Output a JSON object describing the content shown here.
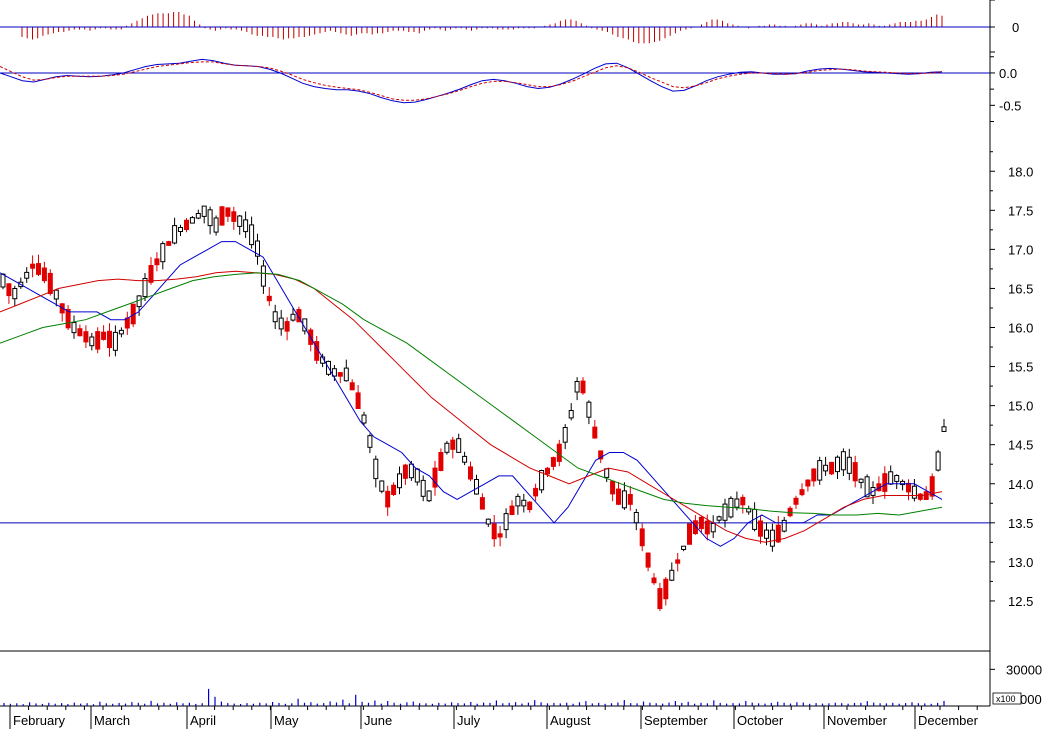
{
  "chart_data": [
    {
      "type": "bar",
      "panel": "histogram",
      "zero_label": "0",
      "values": [
        -0.08,
        -0.09,
        -0.1,
        -0.09,
        -0.07,
        -0.06,
        -0.05,
        -0.04,
        -0.04,
        -0.03,
        -0.02,
        -0.02,
        -0.02,
        -0.03,
        -0.02,
        -0.01,
        -0.01,
        -0.02,
        -0.02,
        -0.02,
        0.01,
        0.03,
        0.05,
        0.07,
        0.09,
        0.1,
        0.11,
        0.11,
        0.11,
        0.12,
        0.12,
        0.1,
        0.09,
        0.05,
        0.02,
        -0.01,
        -0.02,
        -0.03,
        -0.02,
        -0.01,
        -0.02,
        -0.02,
        -0.03,
        -0.04,
        -0.06,
        -0.07,
        -0.07,
        -0.08,
        -0.08,
        -0.09,
        -0.1,
        -0.09,
        -0.09,
        -0.08,
        -0.08,
        -0.07,
        -0.06,
        -0.05,
        -0.04,
        -0.03,
        -0.04,
        -0.05,
        -0.06,
        -0.07,
        -0.06,
        -0.05,
        -0.05,
        -0.06,
        -0.05,
        -0.05,
        -0.04,
        -0.03,
        -0.03,
        -0.03,
        -0.04,
        -0.04,
        -0.05,
        -0.03,
        -0.02,
        -0.01,
        -0.02,
        -0.03,
        -0.02,
        -0.01,
        -0.01,
        -0.02,
        -0.03,
        -0.02,
        -0.01,
        -0.01,
        -0.01,
        -0.02,
        -0.02,
        -0.02,
        -0.02,
        -0.01,
        -0.01,
        -0.01,
        -0.01,
        0.0,
        0.01,
        0.02,
        0.03,
        0.05,
        0.06,
        0.06,
        0.05,
        0.03,
        0.01,
        -0.01,
        -0.02,
        -0.03,
        -0.04,
        -0.06,
        -0.08,
        -0.09,
        -0.1,
        -0.12,
        -0.13,
        -0.13,
        -0.13,
        -0.12,
        -0.11,
        -0.09,
        -0.07,
        -0.05,
        -0.03,
        -0.02,
        -0.01,
        0.0,
        0.02,
        0.04,
        0.06,
        0.06,
        0.05,
        0.03,
        0.02,
        0.01,
        0.0,
        -0.01,
        0.0,
        0.01,
        0.01,
        0.02,
        0.02,
        0.01,
        0.01,
        0.0,
        0.01,
        0.02,
        0.03,
        0.03,
        0.02,
        0.01,
        0.02,
        0.03,
        0.03,
        0.04,
        0.04,
        0.03,
        0.02,
        0.02,
        0.03,
        0.02,
        0.01,
        0.01,
        0.02,
        0.03,
        0.04,
        0.04,
        0.04,
        0.05,
        0.05,
        0.06,
        0.08,
        0.1,
        0.09
      ],
      "ylim": [
        -0.2,
        0.2
      ]
    },
    {
      "type": "line",
      "panel": "oscillator",
      "tick_labels": [
        "0.0",
        "-0.5"
      ],
      "ylim": [
        -0.85,
        0.2
      ],
      "series": [
        {
          "values": [
            0.0,
            -0.06,
            -0.12,
            -0.14,
            -0.1,
            -0.06,
            -0.04,
            -0.05,
            -0.06,
            -0.05,
            -0.03,
            0.0,
            0.05,
            0.1,
            0.13,
            0.14,
            0.15,
            0.18,
            0.21,
            0.19,
            0.15,
            0.12,
            0.11,
            0.1,
            0.06,
            0.0,
            -0.08,
            -0.16,
            -0.21,
            -0.24,
            -0.26,
            -0.26,
            -0.28,
            -0.32,
            -0.38,
            -0.43,
            -0.46,
            -0.45,
            -0.41,
            -0.36,
            -0.31,
            -0.25,
            -0.18,
            -0.12,
            -0.1,
            -0.12,
            -0.16,
            -0.21,
            -0.24,
            -0.22,
            -0.17,
            -0.1,
            -0.02,
            0.07,
            0.14,
            0.15,
            0.08,
            -0.02,
            -0.12,
            -0.21,
            -0.28,
            -0.27,
            -0.2,
            -0.12,
            -0.06,
            -0.02,
            0.01,
            0.02,
            0.0,
            -0.02,
            -0.02,
            -0.01,
            0.03,
            0.06,
            0.07,
            0.06,
            0.04,
            0.02,
            0.01,
            0.0,
            -0.01,
            -0.02,
            -0.01,
            0.01,
            0.02
          ]
        },
        {
          "values": [
            0.1,
            0.02,
            -0.06,
            -0.11,
            -0.1,
            -0.07,
            -0.05,
            -0.05,
            -0.05,
            -0.05,
            -0.04,
            -0.02,
            0.02,
            0.06,
            0.1,
            0.12,
            0.14,
            0.16,
            0.17,
            0.17,
            0.14,
            0.12,
            0.11,
            0.1,
            0.08,
            0.03,
            -0.03,
            -0.1,
            -0.15,
            -0.19,
            -0.22,
            -0.24,
            -0.26,
            -0.3,
            -0.35,
            -0.4,
            -0.42,
            -0.42,
            -0.4,
            -0.36,
            -0.32,
            -0.27,
            -0.21,
            -0.16,
            -0.13,
            -0.13,
            -0.15,
            -0.18,
            -0.21,
            -0.21,
            -0.18,
            -0.13,
            -0.06,
            0.01,
            0.08,
            0.11,
            0.08,
            0.01,
            -0.07,
            -0.14,
            -0.21,
            -0.23,
            -0.2,
            -0.15,
            -0.09,
            -0.05,
            -0.02,
            0.0,
            0.0,
            -0.01,
            -0.02,
            -0.01,
            0.01,
            0.04,
            0.05,
            0.06,
            0.05,
            0.03,
            0.02,
            0.01,
            0.0,
            -0.01,
            -0.01,
            0.0,
            0.02
          ]
        }
      ]
    },
    {
      "type": "line",
      "panel": "price",
      "tick_labels": [
        "18.0",
        "17.5",
        "17.0",
        "16.5",
        "16.0",
        "15.5",
        "15.0",
        "14.5",
        "14.0",
        "13.5",
        "13.0",
        "12.5"
      ],
      "ylim": [
        12.0,
        18.4
      ],
      "support_line": 13.5,
      "series": [
        {
          "values": [
            16.6,
            16.4,
            16.6,
            16.8,
            16.7,
            16.5,
            16.2,
            16.0,
            15.9,
            15.8,
            15.9,
            15.8,
            16.0,
            16.2,
            16.5,
            16.8,
            17.0,
            17.2,
            17.3,
            17.4,
            17.5,
            17.3,
            17.5,
            17.4,
            17.3,
            17.1,
            16.5,
            16.1,
            16.0,
            16.2,
            16.0,
            15.7,
            15.5,
            15.4,
            15.4,
            15.1,
            14.7,
            14.1,
            13.8,
            14.0,
            14.2,
            14.1,
            13.8,
            14.2,
            14.5,
            14.5,
            14.2,
            13.9,
            13.5,
            13.3,
            13.6,
            13.8,
            13.7,
            14.0,
            14.2,
            14.4,
            14.8,
            15.4,
            14.9,
            14.4,
            14.0,
            13.8,
            13.8,
            13.4,
            12.9,
            12.5,
            12.8,
            13.1,
            13.4,
            13.5,
            13.4,
            13.6,
            13.7,
            13.8,
            13.6,
            13.4,
            13.3,
            13.4,
            13.7,
            13.9,
            14.1,
            14.2,
            14.2,
            14.3,
            14.2,
            14.0,
            13.9,
            14.0,
            14.1,
            14.0,
            13.9,
            13.8,
            14.0,
            14.7
          ]
        },
        {
          "values": [
            16.7,
            16.6,
            16.5,
            16.4,
            16.3,
            16.2,
            16.2,
            16.2,
            16.1,
            16.1,
            16.2,
            16.4,
            16.6,
            16.8,
            16.9,
            17.0,
            17.1,
            17.1,
            17.0,
            16.9,
            16.6,
            16.3,
            16.0,
            15.7,
            15.4,
            15.1,
            14.8,
            14.6,
            14.5,
            14.4,
            14.2,
            14.1,
            13.9,
            13.8,
            13.9,
            14.0,
            14.1,
            14.1,
            13.9,
            13.7,
            13.5,
            13.7,
            14.0,
            14.3,
            14.4,
            14.4,
            14.3,
            14.1,
            13.9,
            13.7,
            13.5,
            13.3,
            13.2,
            13.3,
            13.5,
            13.6,
            13.5,
            13.5,
            13.5,
            13.6,
            13.6,
            13.7,
            13.8,
            13.9,
            14.0,
            14.0,
            14.0,
            13.9,
            13.8
          ]
        },
        {
          "values": [
            16.2,
            16.3,
            16.4,
            16.5,
            16.55,
            16.6,
            16.62,
            16.6,
            16.6,
            16.62,
            16.65,
            16.7,
            16.72,
            16.7,
            16.68,
            16.62,
            16.5,
            16.3,
            16.1,
            15.85,
            15.6,
            15.35,
            15.1,
            14.9,
            14.7,
            14.5,
            14.35,
            14.2,
            14.1,
            14.0,
            14.1,
            14.2,
            14.15,
            14.0,
            13.85,
            13.7,
            13.55,
            13.4,
            13.3,
            13.25,
            13.3,
            13.4,
            13.55,
            13.7,
            13.8,
            13.85,
            13.85,
            13.85,
            13.9
          ]
        },
        {
          "values": [
            15.8,
            15.9,
            16.0,
            16.05,
            16.1,
            16.2,
            16.3,
            16.4,
            16.5,
            16.6,
            16.65,
            16.68,
            16.7,
            16.68,
            16.6,
            16.45,
            16.3,
            16.1,
            15.95,
            15.8,
            15.6,
            15.4,
            15.2,
            15.0,
            14.8,
            14.6,
            14.4,
            14.2,
            14.1,
            14.0,
            13.9,
            13.8,
            13.75,
            13.72,
            13.7,
            13.68,
            13.65,
            13.63,
            13.62,
            13.6,
            13.6,
            13.62,
            13.6,
            13.65,
            13.7
          ]
        }
      ]
    },
    {
      "type": "bar",
      "panel": "volume",
      "ylim": [
        0,
        45000
      ],
      "tick_labels": [
        "30000"
      ],
      "unit_label": "x100",
      "unit_tail": "000",
      "values": [
        2500,
        1800,
        2200,
        1500,
        3000,
        2100,
        1700,
        2600,
        1900,
        2400,
        1600,
        2800,
        2000,
        2300,
        1500,
        3500,
        2200,
        1800,
        2500,
        2000,
        3200,
        2600,
        1900,
        4200,
        2100,
        2700,
        1800,
        3000,
        2200,
        2600,
        1700,
        2300,
        14000,
        7500,
        3600,
        2400,
        2000,
        1600,
        2400,
        1900,
        2700,
        2100,
        3300,
        2500,
        1800,
        2200,
        6000,
        2600,
        3100,
        2000,
        2400,
        3800,
        2900,
        5200,
        2200,
        9200,
        3400,
        2600,
        4500,
        2000,
        4100,
        2700,
        1900,
        3000,
        3600,
        2300,
        2200,
        1800,
        2600,
        2000,
        3000,
        2400,
        2100,
        3300,
        1900,
        2800,
        2500,
        4600,
        2200,
        2600,
        3100,
        2000,
        2800,
        4800,
        3000,
        2200,
        2500,
        2100,
        2700,
        1900,
        3000,
        4000,
        2100,
        2600,
        1800,
        2300,
        2900,
        4900,
        2400,
        2200,
        3700,
        2700,
        2300,
        2000,
        2800,
        4100,
        2500,
        3400,
        1900,
        2600,
        2200,
        4700,
        2500,
        2000,
        2400,
        2100,
        4100,
        2800,
        2200,
        2000,
        2500,
        3400,
        2700,
        2000,
        3100,
        2900,
        1800,
        2400,
        2000,
        2200,
        2700,
        2300,
        1900,
        2500,
        2600,
        4000,
        2800,
        2200,
        2100,
        2600,
        1900,
        2400,
        3000,
        2300,
        2100,
        1800,
        2500,
        4200
      ]
    },
    {
      "type": "candlestick",
      "panel": "price",
      "x_tick_labels": [
        "February",
        "March",
        "April",
        "May",
        "June",
        "July",
        "August",
        "September",
        "October",
        "November",
        "December"
      ]
    }
  ]
}
